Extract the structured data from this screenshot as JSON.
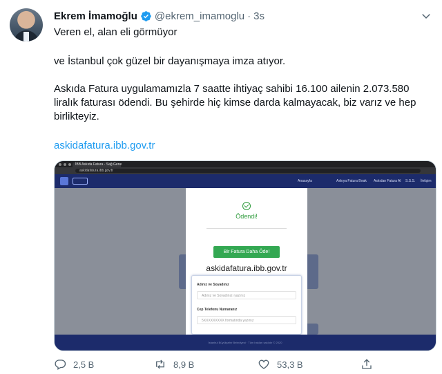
{
  "author": {
    "name": "Ekrem İmamoğlu",
    "handle": "@ekrem_imamoglu",
    "separator": "·",
    "time": "3s",
    "verified_icon": "verified-badge-icon"
  },
  "tweet": {
    "line1": "Veren el, alan eli görmüyor",
    "line2": "ve İstanbul çok güzel bir dayanışmaya imza atıyor.",
    "line3": "Askıda Fatura uygulamamızla 7 saatte ihtiyaç sahibi 16.100 ailenin 2.073.580 liralık faturası ödendi. Bu şehirde hiç kimse darda kalmayacak, biz varız ve hep birlikteyiz.",
    "link": "askidafatura.ibb.gov.tr"
  },
  "media": {
    "browser_tab": "İBB Askıda Fatura - Sağ Gene",
    "browser_url": "askidafatura.ibb.gov.tr",
    "nav": [
      "Anasayfa",
      "Askıya Fatura Bırak",
      "Askıdan Fatura Al",
      "S.S.S.",
      "İletişim"
    ],
    "modal": {
      "status": "Ödendi!",
      "button": "Bir Fatura Daha Öde!",
      "domain": "askidafatura.ibb.gov.tr",
      "form": {
        "name_label": "Adınız ve Soyadınız",
        "name_placeholder": "Adınız ve Soyadınızı yazınız",
        "phone_label": "Cep Telefonu Numaranız",
        "phone_placeholder": "5XXXXXXXXX formatında yazınız"
      }
    },
    "footer": "İstanbul Büyükşehir Belediyesi · Tüm hakları saklıdır © 2020"
  },
  "actions": {
    "reply_count": "2,5 B",
    "retweet_count": "8,9 B",
    "like_count": "53,3 B"
  },
  "colors": {
    "accent": "#1d9bf0",
    "verified": "#1d9bf0",
    "secondary_text": "#536471",
    "success": "#33a852"
  }
}
